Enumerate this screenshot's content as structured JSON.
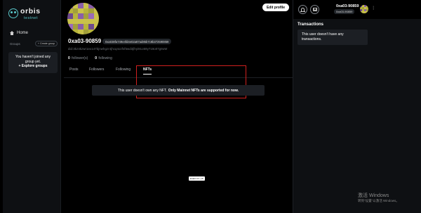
{
  "brand": {
    "name": "orbis",
    "network": "testnet",
    "accent": "#59c7c9"
  },
  "sidebar": {
    "home_label": "Home",
    "groups_label": "Groups",
    "create_group_label": "+ Create group",
    "empty_groups_line1": "You haven't joined any",
    "empty_groups_line2": "group yet.",
    "explore_groups_label": "+ Explore groups"
  },
  "profile": {
    "username": "0xa03-90859",
    "address_pill": "0xa038fa749e4fd4e02a87ad85b7c8b372590859",
    "did": "did:3kz4kzwr1ex147bjnwhgzr4jhcq4ozfsf5wd3jlhyi91o59y719o07g9oW",
    "followers_count": "0",
    "followers_label": "follower(s)",
    "following_count": "0",
    "following_label": "following",
    "edit_profile_label": "Edit profile"
  },
  "tabs": [
    {
      "label": "Posts",
      "active": false
    },
    {
      "label": "Followers",
      "active": false
    },
    {
      "label": "Following",
      "active": false
    },
    {
      "label": "NFTs",
      "active": true
    }
  ],
  "nfts": {
    "notice_prefix": "This user doesn't own any NFT.",
    "notice_bold": "Only Mainnet NFTs are supported for now."
  },
  "tooltip": "Enabl ctrl + W",
  "header": {
    "user_name": "0xa03-90859",
    "user_address": "0xa03-90859"
  },
  "transactions": {
    "title": "Transactions",
    "empty_line1": "This user doesn't have any",
    "empty_line2": "transactions."
  },
  "os_watermark": {
    "line1": "激活 Windows",
    "line2": "转到\"设置\"以激活 Windows。"
  },
  "icons": {
    "home": "home-icon",
    "bell": "bell-icon",
    "mail": "mail-icon",
    "menu": "more-vertical-icon"
  },
  "colors": {
    "background": "#000000",
    "panel": "#0e1013",
    "card": "#1c1f24",
    "highlight": "#d0201f"
  }
}
